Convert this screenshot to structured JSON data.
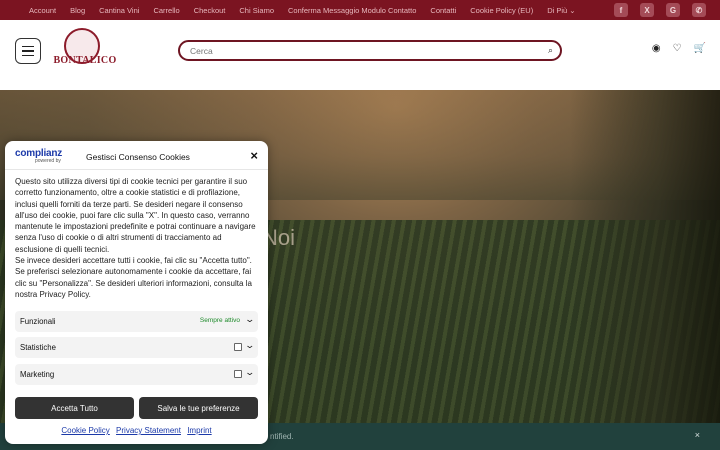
{
  "topbar": {
    "links": [
      "Account",
      "Blog",
      "Cantina Vini",
      "Carrello",
      "Checkout",
      "Chi Siamo",
      "Conferma Messaggio Modulo Contatto",
      "Contatti",
      "Cookie Policy (EU)",
      "Di Più ⌄"
    ],
    "social_icons": [
      "facebook-icon",
      "x-icon",
      "google-icon",
      "phone-icon"
    ]
  },
  "header": {
    "logo_text": "BONTALICO",
    "search_placeholder": "Cerca"
  },
  "hero": {
    "title": "Noi"
  },
  "footer": {
    "text": "ntified.",
    "close": "×"
  },
  "cookie": {
    "brand": "complianz",
    "brand_sub": "powered by",
    "title": "Gestisci Consenso Cookies",
    "close": "×",
    "body": "Questo sito utilizza diversi tipi di cookie tecnici per garantire il suo corretto funzionamento, oltre a cookie statistici e di profilazione, inclusi quelli forniti da terze parti. Se desideri negare il consenso all'uso dei cookie, puoi fare clic sulla \"X\". In questo caso, verranno mantenute le impostazioni predefinite e potrai continuare a navigare senza l'uso di cookie o di altri strumenti di tracciamento ad esclusione di quelli tecnici.\nSe invece desideri accettare tutti i cookie, fai clic su \"Accetta tutto\". Se preferisci selezionare autonomamente i cookie da accettare, fai clic su \"Personalizza\". Se desideri ulteriori informazioni, consulta la nostra Privacy Policy.",
    "categories": [
      {
        "label": "Funzionali",
        "state": "Sempre attivo"
      },
      {
        "label": "Statistiche",
        "state": ""
      },
      {
        "label": "Marketing",
        "state": ""
      }
    ],
    "accept_label": "Accetta Tutto",
    "save_label": "Salva le tue preferenze",
    "links": [
      "Cookie Policy",
      "Privacy Statement",
      "Imprint"
    ]
  }
}
